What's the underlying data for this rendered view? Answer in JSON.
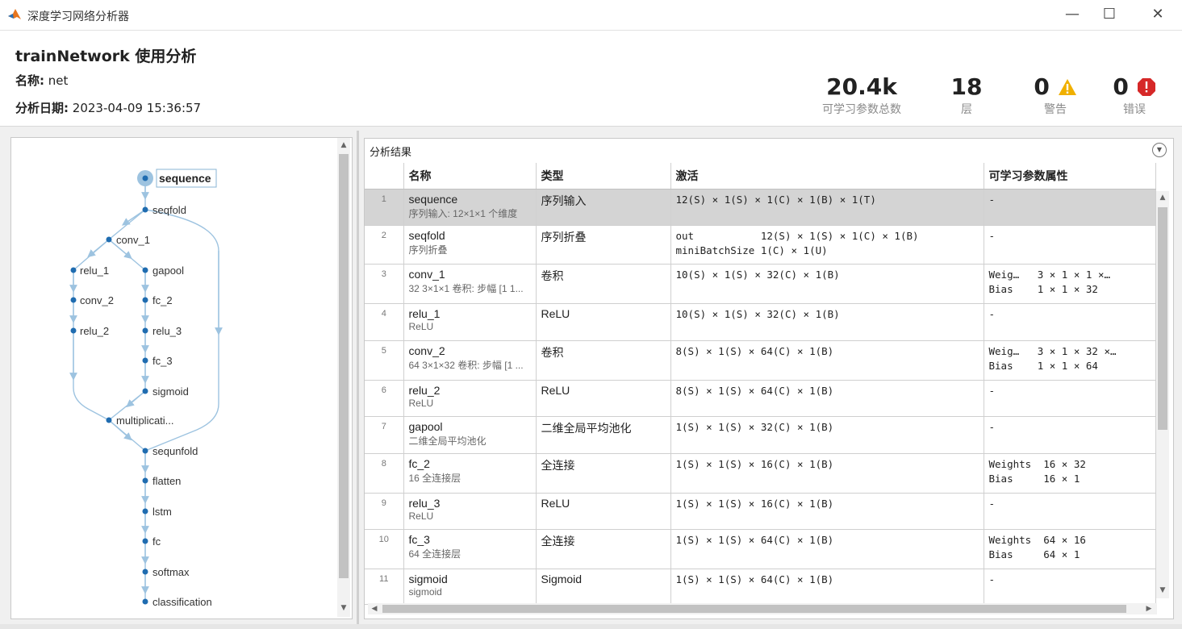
{
  "window": {
    "title": "深度学习网络分析器",
    "minimize": "—",
    "maximize": "☐",
    "close": "✕"
  },
  "header": {
    "title": "trainNetwork 使用分析",
    "name_label": "名称:",
    "name_value": "net",
    "date_label": "分析日期:",
    "date_value": "2023-04-09 15:36:57"
  },
  "stats": [
    {
      "value": "20.4k",
      "label": "可学习参数总数"
    },
    {
      "value": "18",
      "label": "层"
    },
    {
      "value": "0",
      "label": "警告"
    },
    {
      "value": "0",
      "label": "错误"
    }
  ],
  "graph": {
    "nodes": [
      "sequence",
      "seqfold",
      "conv_1",
      "relu_1",
      "conv_2",
      "relu_2",
      "gapool",
      "fc_2",
      "relu_3",
      "fc_3",
      "sigmoid",
      "multiplicati...",
      "sequnfold",
      "flatten",
      "lstm",
      "fc",
      "softmax",
      "classification"
    ],
    "selected": "sequence"
  },
  "results": {
    "title": "分析结果",
    "columns": [
      "名称",
      "类型",
      "激活",
      "可学习参数属性"
    ],
    "rows": [
      {
        "idx": "1",
        "name": "sequence",
        "desc": "序列输入: 12×1×1 个维度",
        "type": "序列输入",
        "act": "12(S) × 1(S) × 1(C) × 1(B) × 1(T)",
        "learn": "-"
      },
      {
        "idx": "2",
        "name": "seqfold",
        "desc": "序列折叠",
        "type": "序列折叠",
        "act": "out           12(S) × 1(S) × 1(C) × 1(B)\nminiBatchSize 1(C) × 1(U)",
        "learn": "-"
      },
      {
        "idx": "3",
        "name": "conv_1",
        "desc": "32 3×1×1 卷积: 步幅 [1 1...",
        "type": "卷积",
        "act": "10(S) × 1(S) × 32(C) × 1(B)",
        "learn": "Weig…   3 × 1 × 1 ×…\nBias    1 × 1 × 32"
      },
      {
        "idx": "4",
        "name": "relu_1",
        "desc": "ReLU",
        "type": "ReLU",
        "act": "10(S) × 1(S) × 32(C) × 1(B)",
        "learn": "-"
      },
      {
        "idx": "5",
        "name": "conv_2",
        "desc": "64 3×1×32 卷积: 步幅 [1 ...",
        "type": "卷积",
        "act": "8(S) × 1(S) × 64(C) × 1(B)",
        "learn": "Weig…   3 × 1 × 32 ×…\nBias    1 × 1 × 64"
      },
      {
        "idx": "6",
        "name": "relu_2",
        "desc": "ReLU",
        "type": "ReLU",
        "act": "8(S) × 1(S) × 64(C) × 1(B)",
        "learn": "-"
      },
      {
        "idx": "7",
        "name": "gapool",
        "desc": "二维全局平均池化",
        "type": "二维全局平均池化",
        "act": "1(S) × 1(S) × 32(C) × 1(B)",
        "learn": "-"
      },
      {
        "idx": "8",
        "name": "fc_2",
        "desc": "16 全连接层",
        "type": "全连接",
        "act": "1(S) × 1(S) × 16(C) × 1(B)",
        "learn": "Weights  16 × 32\nBias     16 × 1"
      },
      {
        "idx": "9",
        "name": "relu_3",
        "desc": "ReLU",
        "type": "ReLU",
        "act": "1(S) × 1(S) × 16(C) × 1(B)",
        "learn": "-"
      },
      {
        "idx": "10",
        "name": "fc_3",
        "desc": "64 全连接层",
        "type": "全连接",
        "act": "1(S) × 1(S) × 64(C) × 1(B)",
        "learn": "Weights  64 × 16\nBias     64 × 1"
      },
      {
        "idx": "11",
        "name": "sigmoid",
        "desc": "sigmoid",
        "type": "Sigmoid",
        "act": "1(S) × 1(S) × 64(C) × 1(B)",
        "learn": "-"
      }
    ]
  },
  "colors": {
    "graph_line": "#9dc3e0",
    "node_dot": "#1f6cb0",
    "warn": "#f0b000",
    "error": "#d62828",
    "selected_row": "#d4d4d4"
  },
  "icons": {
    "app": "matlab-logo-icon",
    "warning": "warning-triangle-icon",
    "error": "error-octagon-icon"
  }
}
